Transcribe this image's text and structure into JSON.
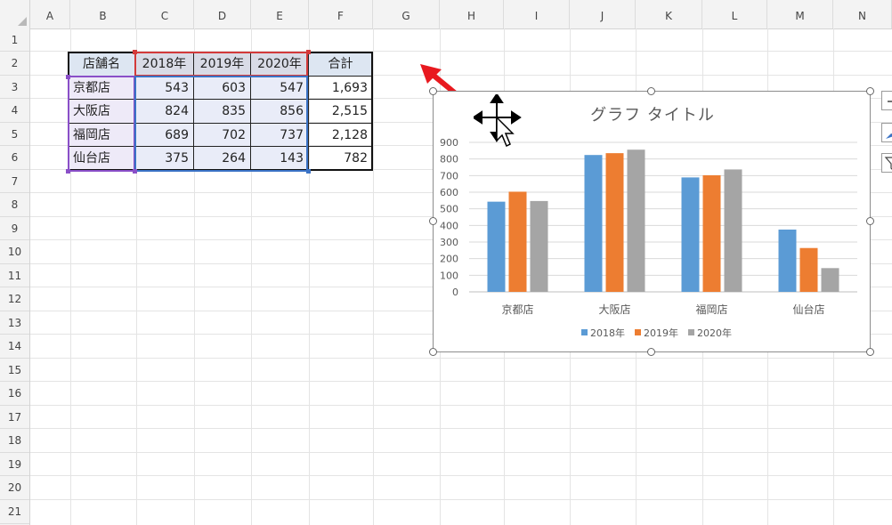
{
  "columns": [
    "A",
    "B",
    "C",
    "D",
    "E",
    "F",
    "G",
    "H",
    "I",
    "J",
    "K",
    "L",
    "M",
    "N"
  ],
  "rows": [
    "1",
    "2",
    "3",
    "4",
    "5",
    "6",
    "7",
    "8",
    "9",
    "10",
    "11",
    "12",
    "13",
    "14",
    "15",
    "16",
    "17",
    "18",
    "19",
    "20",
    "21"
  ],
  "table": {
    "headers": [
      "店舗名",
      "2018年",
      "2019年",
      "2020年",
      "合計"
    ],
    "rows": [
      [
        "京都店",
        "543",
        "603",
        "547",
        "1,693"
      ],
      [
        "大阪店",
        "824",
        "835",
        "856",
        "2,515"
      ],
      [
        "福岡店",
        "689",
        "702",
        "737",
        "2,128"
      ],
      [
        "仙台店",
        "375",
        "264",
        "143",
        "782"
      ]
    ]
  },
  "chart_data": {
    "type": "bar",
    "title": "グラフ タイトル",
    "categories": [
      "京都店",
      "大阪店",
      "福岡店",
      "仙台店"
    ],
    "series": [
      {
        "name": "2018年",
        "values": [
          543,
          824,
          689,
          375
        ],
        "color": "#5b9bd5"
      },
      {
        "name": "2019年",
        "values": [
          603,
          835,
          702,
          264
        ],
        "color": "#ed7d31"
      },
      {
        "name": "2020年",
        "values": [
          547,
          856,
          737,
          143
        ],
        "color": "#a5a5a5"
      }
    ],
    "ylim": [
      0,
      900
    ],
    "yticks": [
      "0",
      "100",
      "200",
      "300",
      "400",
      "500",
      "600",
      "700",
      "800",
      "900"
    ],
    "grid": true,
    "legend_position": "bottom"
  },
  "colors": {
    "arrow": "#e8191f",
    "selection_red": "#d33a3a",
    "selection_blue": "#3b73c6",
    "selection_purple": "#8a4fc8"
  },
  "icons": {
    "move_cursor": "move-cursor-icon",
    "pointer": "arrow-pointer-icon",
    "annotation": "red-arrow-icon"
  }
}
